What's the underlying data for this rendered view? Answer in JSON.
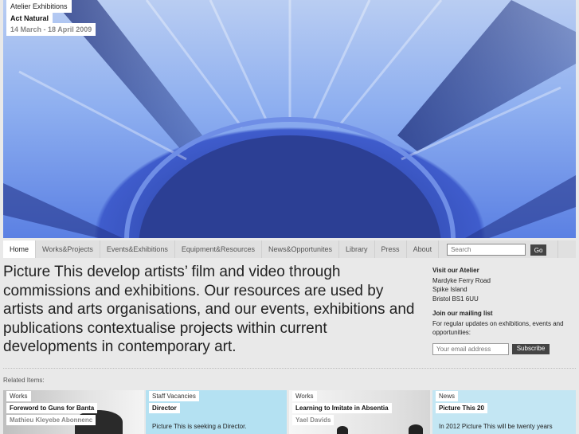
{
  "hero": {
    "category": "Atelier Exhibitions",
    "title": "Act Natural",
    "dates": "14 March - 18 April 2009"
  },
  "nav": {
    "items": [
      "Home",
      "Works&Projects",
      "Events&Exhibitions",
      "Equipment&Resources",
      "News&Opportunites",
      "Library",
      "Press",
      "About"
    ],
    "search_placeholder": "Search",
    "go_label": "Go"
  },
  "intro": "Picture This develop artists’ film and video through commissions and exhibitions. Our resources are used by artists and arts organisations, and our events, exhibitions and publications contextualise projects within current developments in contemporary art.",
  "sidebar": {
    "visit_title": "Visit our Atelier",
    "address": [
      "Mardyke Ferry Road",
      "Spike Island",
      "Bristol BS1 6UU"
    ],
    "mailing_title": "Join our mailing list",
    "mailing_text": "For regular updates on exhibitions, events and opportunities:",
    "email_placeholder": "Your email address",
    "subscribe_label": "Subscribe"
  },
  "related_label": "Related Items:",
  "cards": [
    {
      "tag": "Works",
      "title": "Foreword to Guns for Banta",
      "subtitle": "Mathieu Kleyebe Abonnenc"
    },
    {
      "tag": "Staff Vacancies",
      "title": "Director",
      "text": "Picture This is seeking a Director."
    },
    {
      "tag": "Works",
      "title": "Learning to Imitate in Absentia",
      "subtitle": "Yael Davids"
    },
    {
      "tag": "News",
      "title": "Picture This 20",
      "text": "In 2012 Picture This will be twenty years"
    }
  ],
  "colors": {
    "hero_blue": "#3550b8",
    "button_dark": "#444444",
    "card_blue": "#b4e1f2"
  }
}
